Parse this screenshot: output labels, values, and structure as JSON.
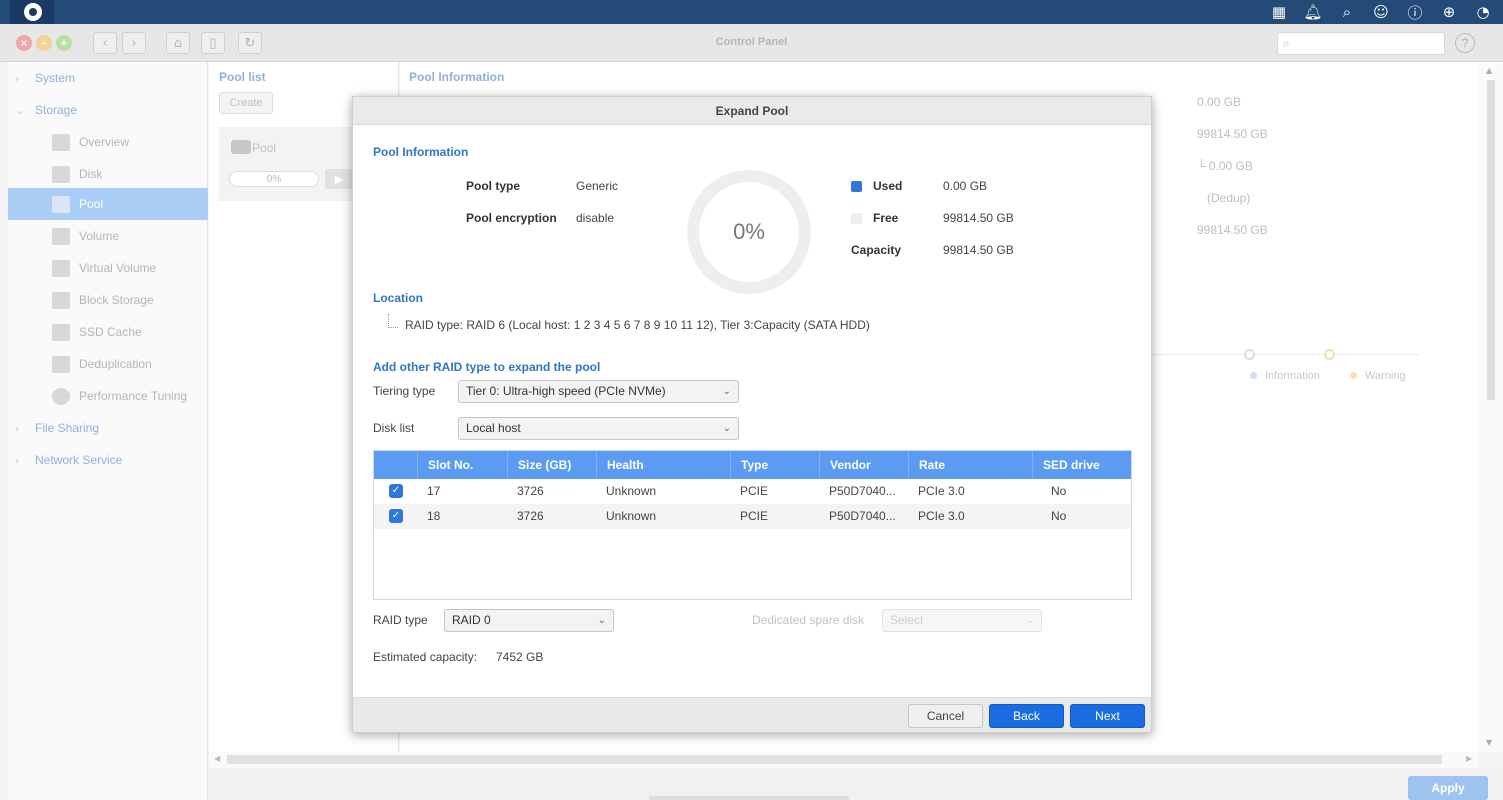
{
  "window": {
    "title": "Control Panel"
  },
  "topbar_icons": [
    "apps-icon",
    "bell-icon",
    "search-icon",
    "user-icon",
    "help-icon",
    "globe-icon",
    "dashboard-icon"
  ],
  "sidebar": {
    "groups": [
      {
        "label": "System"
      },
      {
        "label": "Storage"
      },
      {
        "label": "File Sharing"
      },
      {
        "label": "Network Service"
      }
    ],
    "items": [
      {
        "label": "Overview"
      },
      {
        "label": "Disk"
      },
      {
        "label": "Pool"
      },
      {
        "label": "Volume"
      },
      {
        "label": "Virtual Volume"
      },
      {
        "label": "Block Storage"
      },
      {
        "label": "SSD Cache"
      },
      {
        "label": "Deduplication"
      },
      {
        "label": "Performance Tuning"
      }
    ]
  },
  "pool_list": {
    "title": "Pool list",
    "create_label": "Create",
    "pool_name": "Pool",
    "pool_progress": "0%"
  },
  "main": {
    "title": "Pool Information",
    "values": [
      "0.00 GB",
      "99814.50 GB",
      "└ 0.00 GB",
      "(Dedup)",
      "99814.50 GB"
    ],
    "legend_information": "Information",
    "legend_warning": "Warning"
  },
  "footer": {
    "apply_label": "Apply"
  },
  "modal": {
    "title": "Expand Pool",
    "pool_info_title": "Pool Information",
    "pool_type_label": "Pool type",
    "pool_type_value": "Generic",
    "pool_encryption_label": "Pool encryption",
    "pool_encryption_value": "disable",
    "usage_percent": "0%",
    "used_label": "Used",
    "used_value": "0.00 GB",
    "free_label": "Free",
    "free_value": "99814.50 GB",
    "capacity_label": "Capacity",
    "capacity_value": "99814.50 GB",
    "used_color": "#2f77d8",
    "free_color": "#eeeeee",
    "location_title": "Location",
    "location_text": "RAID type: RAID 6 (Local host: 1 2 3 4 5 6 7 8 9 10 11 12), Tier 3:Capacity (SATA HDD)",
    "add_title": "Add other RAID type to expand the pool",
    "tiering_label": "Tiering type",
    "tiering_value": "Tier 0: Ultra-high speed (PCIe NVMe)",
    "disk_list_label": "Disk list",
    "disk_list_value": "Local host",
    "table": {
      "headers": [
        "Slot No.",
        "Size (GB)",
        "Health",
        "Type",
        "Vendor",
        "Rate",
        "SED drive"
      ],
      "rows": [
        {
          "slot": "17",
          "size": "3726",
          "health": "Unknown",
          "type": "PCIE",
          "vendor": "P50D7040...",
          "rate": "PCIe 3.0",
          "sed": "No"
        },
        {
          "slot": "18",
          "size": "3726",
          "health": "Unknown",
          "type": "PCIE",
          "vendor": "P50D7040...",
          "rate": "PCIe 3.0",
          "sed": "No"
        }
      ]
    },
    "raid_type_label": "RAID type",
    "raid_type_value": "RAID 0",
    "spare_label": "Dedicated spare disk",
    "spare_placeholder": "Select",
    "estimated_label": "Estimated capacity:",
    "estimated_value": "7452 GB",
    "cancel_label": "Cancel",
    "back_label": "Back",
    "next_label": "Next"
  }
}
